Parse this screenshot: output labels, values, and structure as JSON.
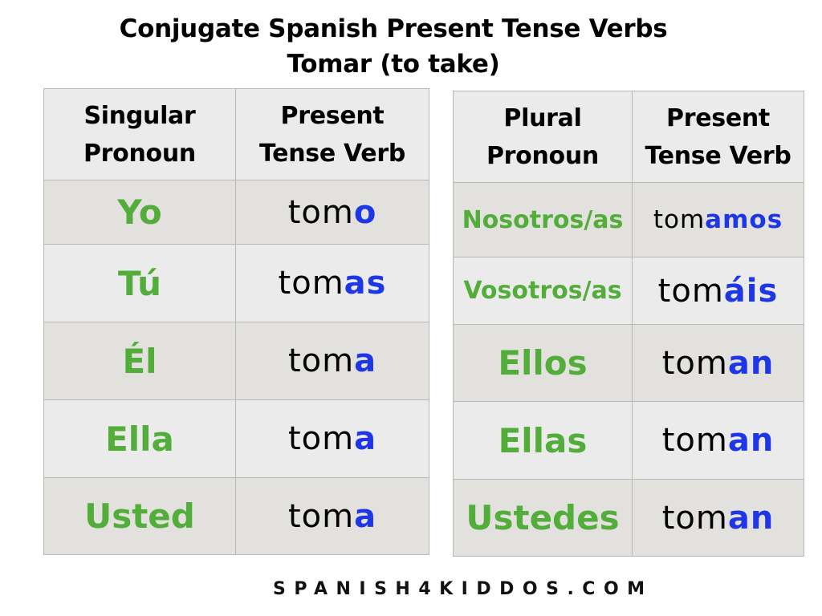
{
  "title": {
    "line1": "Conjugate Spanish Present Tense Verbs",
    "line2": "Tomar (to take)"
  },
  "colors": {
    "pronoun": "#52ad3b",
    "ending": "#1e37e6",
    "header_bg": "#ebebeb",
    "alt_bg": "#e2e1dd"
  },
  "singular": {
    "headers": [
      {
        "line1": "Singular",
        "line2": "Pronoun"
      },
      {
        "line1": "Present",
        "line2": "Tense Verb"
      }
    ],
    "rows": [
      {
        "pronoun": "Yo",
        "stem": "tom",
        "ending": "o"
      },
      {
        "pronoun": "Tú",
        "stem": "tom",
        "ending": "as"
      },
      {
        "pronoun": "Él",
        "stem": "tom",
        "ending": "a"
      },
      {
        "pronoun": "Ella",
        "stem": "tom",
        "ending": "a"
      },
      {
        "pronoun": "Usted",
        "stem": "tom",
        "ending": "a"
      }
    ]
  },
  "plural": {
    "headers": [
      {
        "line1": "Plural",
        "line2": "Pronoun"
      },
      {
        "line1": "Present",
        "line2": "Tense Verb"
      }
    ],
    "rows": [
      {
        "pronoun": "Nosotros/as",
        "stem": "tom",
        "ending": "amos"
      },
      {
        "pronoun": "Vosotros/as",
        "stem": "tom",
        "ending": "áis"
      },
      {
        "pronoun": "Ellos",
        "stem": "tom",
        "ending": "an"
      },
      {
        "pronoun": "Ellas",
        "stem": "tom",
        "ending": "an"
      },
      {
        "pronoun": "Ustedes",
        "stem": "tom",
        "ending": "an"
      }
    ]
  },
  "footer": {
    "website": "SPANISH4KIDDOS.COM"
  }
}
